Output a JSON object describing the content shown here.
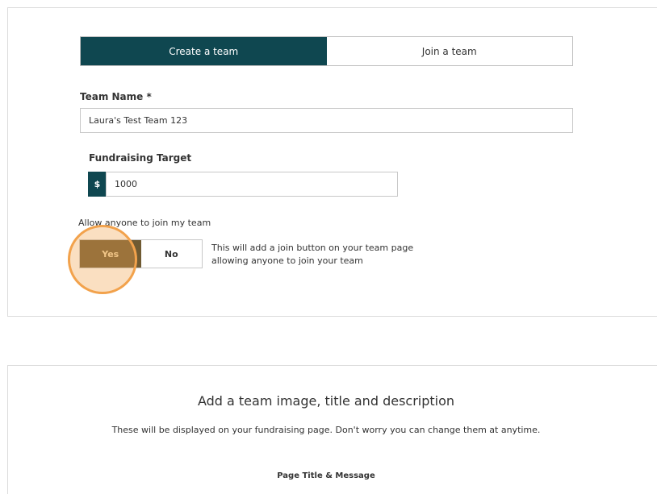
{
  "tabs": [
    {
      "label": "Create a team",
      "active": true
    },
    {
      "label": "Join a team",
      "active": false
    }
  ],
  "team_name": {
    "label": "Team Name *",
    "value": "Laura's Test Team 123"
  },
  "fundraising": {
    "label": "Fundraising Target",
    "currency_symbol": "$",
    "value": "1000"
  },
  "join_setting": {
    "label": "Allow anyone to join my team",
    "yes_label": "Yes",
    "no_label": "No",
    "selected": "Yes",
    "hint_line1": "This will add a join button on your team page",
    "hint_line2": "allowing anyone to join your team"
  },
  "team_image_section": {
    "title": "Add a team image, title and description",
    "subtitle": "These will be displayed on your fundraising page. Don't worry you can change them at anytime.",
    "page_title_label": "Page Title & Message"
  },
  "colors": {
    "primary": "#0f4750",
    "selected_toggle": "#6f5a32",
    "highlight": "#f2a24c"
  }
}
